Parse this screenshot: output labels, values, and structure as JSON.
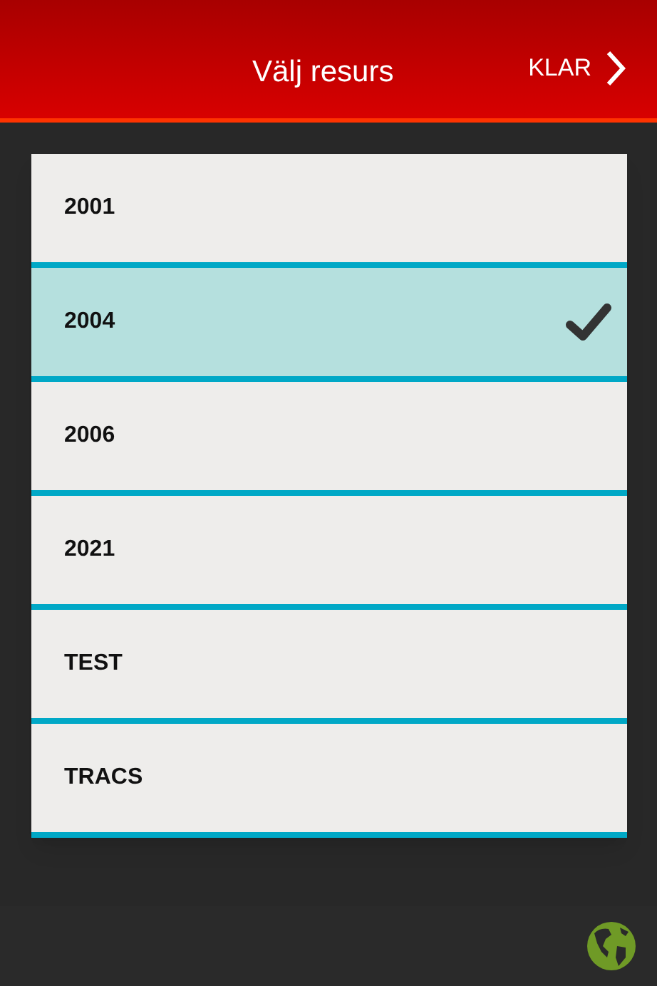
{
  "header": {
    "title": "Välj resurs",
    "done_button": "KLAR"
  },
  "resources": [
    {
      "label": "2001",
      "selected": false
    },
    {
      "label": "2004",
      "selected": true
    },
    {
      "label": "2006",
      "selected": false
    },
    {
      "label": "2021",
      "selected": false
    },
    {
      "label": "TEST",
      "selected": false
    },
    {
      "label": "TRACS",
      "selected": false
    }
  ]
}
